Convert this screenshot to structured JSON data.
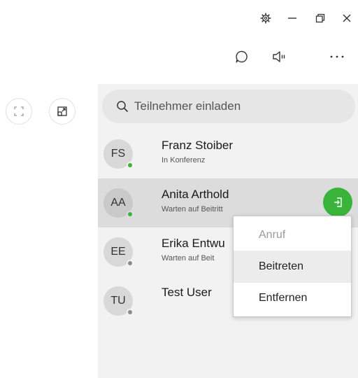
{
  "search": {
    "placeholder": "Teilnehmer einladen"
  },
  "participants": [
    {
      "initials": "FS",
      "name": "Franz Stoiber",
      "status": "In Konferenz",
      "presence": "#3ab33a"
    },
    {
      "initials": "AA",
      "name": "Anita Arthold",
      "status": "Warten auf Beitritt",
      "presence": "#3ab33a"
    },
    {
      "initials": "EE",
      "name": "Erika Entwu",
      "status": "Warten auf Beit",
      "presence": "#8a8a8a"
    },
    {
      "initials": "TU",
      "name": "Test User",
      "status": "",
      "presence": "#8a8a8a"
    }
  ],
  "context_menu": {
    "items": [
      {
        "label": "Anruf",
        "disabled": true
      },
      {
        "label": "Beitreten",
        "disabled": false
      },
      {
        "label": "Entfernen",
        "disabled": false
      }
    ]
  },
  "colors": {
    "accent": "#3ab33a",
    "selected_row": "#dcdcdc",
    "panel": "#f2f2f2"
  }
}
